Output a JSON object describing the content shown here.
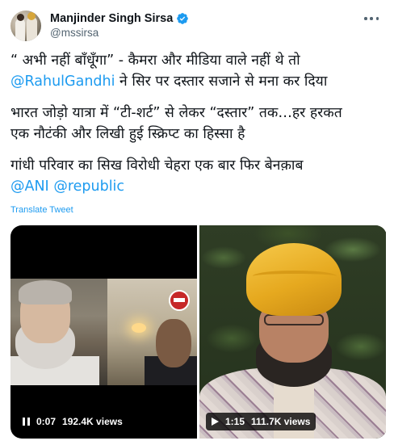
{
  "author": {
    "display_name": "Manjinder Singh Sirsa",
    "handle": "@mssirsa",
    "verified_icon": "verified-badge-icon",
    "avatar": "avatar"
  },
  "menu": {
    "more_icon": "more-options-icon"
  },
  "tweet": {
    "line1": "“ अभी नहीं बाँधूँगा” - कैमरा और मीडिया वाले नहीं थे तो",
    "line2_mention": "@RahulGandhi",
    "line2_rest": " ने सिर पर दस्तार सजाने से मना कर दिया",
    "line3": "भारत जोड़ो यात्रा में “टी-शर्ट” से लेकर “दस्तार” तक…हर हरकत",
    "line4": "एक नौटंकी और लिखी हुई स्क्रिप्ट का हिस्सा है",
    "line5": "गांधी परिवार का सिख विरोधी चेहरा एक बार फिर बेनक़ाब",
    "mention1": "@ANI",
    "mention2": "@republic"
  },
  "translate_label": "Translate Tweet",
  "videos": [
    {
      "time": "0:07",
      "views": "192.4K views",
      "control_icon": "pause-icon"
    },
    {
      "time": "1:15",
      "views": "111.7K views",
      "control_icon": "play-icon"
    }
  ],
  "colors": {
    "accent": "#1d9bf0",
    "text": "#0f1419",
    "secondary": "#536471"
  }
}
